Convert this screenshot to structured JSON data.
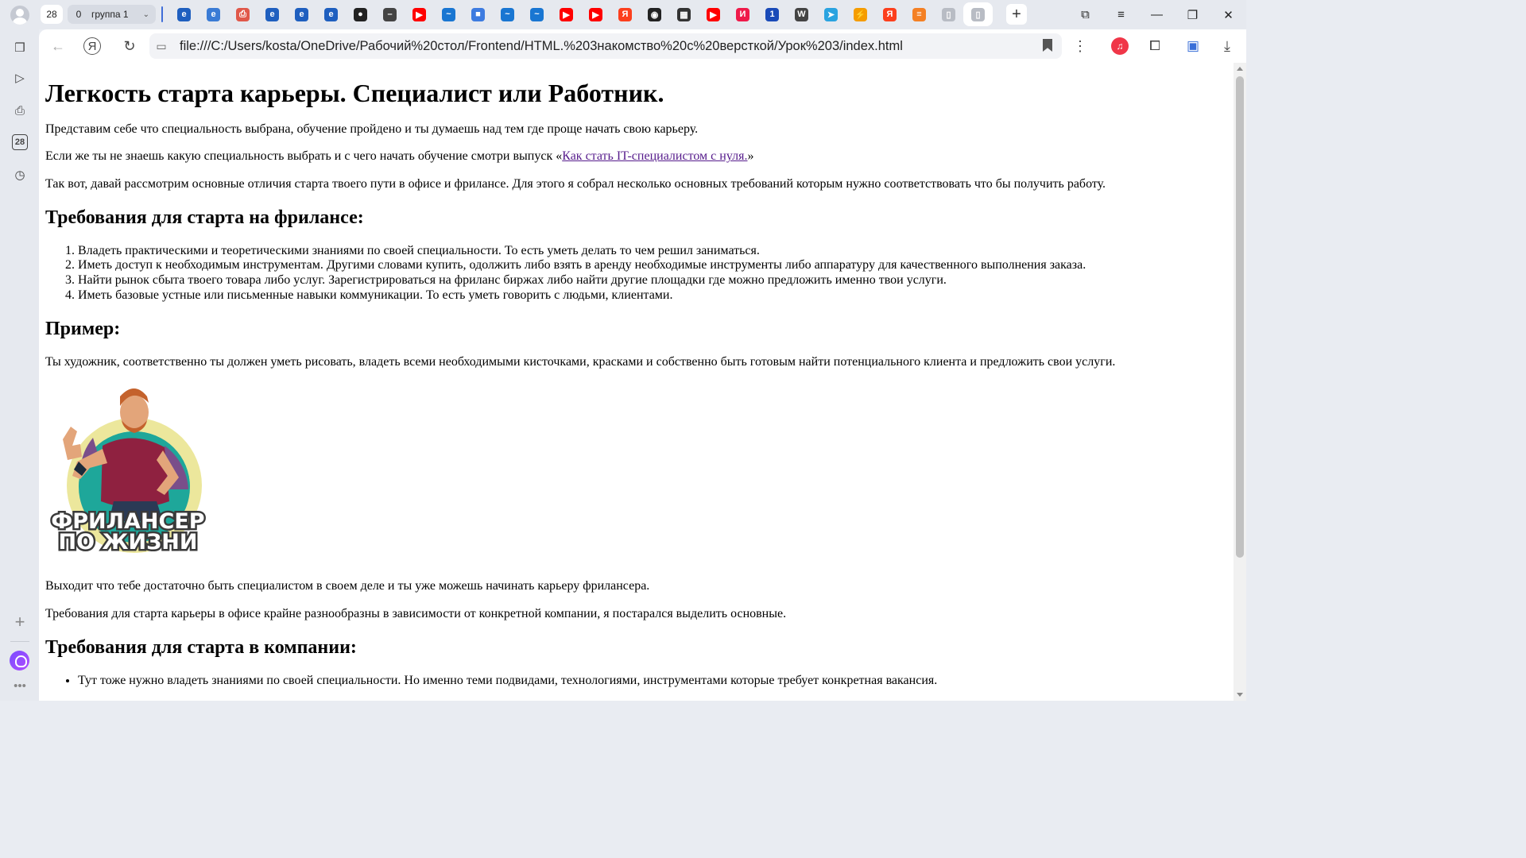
{
  "browser": {
    "tab_count": "28",
    "group": {
      "count": "0",
      "name": "группа 1"
    },
    "pinned_tabs": [
      {
        "name": "edge-icon",
        "color": "#1f5fbf",
        "glyph": "e"
      },
      {
        "name": "ie-icon",
        "color": "#3a7bd5",
        "glyph": "e"
      },
      {
        "name": "pdf-icon",
        "color": "#e0584a",
        "glyph": "⎙"
      },
      {
        "name": "edge-icon",
        "color": "#1f5fbf",
        "glyph": "e"
      },
      {
        "name": "edge-icon",
        "color": "#1f5fbf",
        "glyph": "e"
      },
      {
        "name": "edge-icon",
        "color": "#1f5fbf",
        "glyph": "e"
      },
      {
        "name": "github-icon",
        "color": "#222222",
        "glyph": "●"
      },
      {
        "name": "minus-icon",
        "color": "#444444",
        "glyph": "–"
      },
      {
        "name": "youtube-icon",
        "color": "#ff0000",
        "glyph": "▶"
      },
      {
        "name": "feather-icon",
        "color": "#1976d2",
        "glyph": "~"
      },
      {
        "name": "cube-icon",
        "color": "#3d7be0",
        "glyph": "■"
      },
      {
        "name": "feather-icon",
        "color": "#1976d2",
        "glyph": "~"
      },
      {
        "name": "feather-icon",
        "color": "#1976d2",
        "glyph": "~"
      },
      {
        "name": "youtube-icon",
        "color": "#ff0000",
        "glyph": "▶"
      },
      {
        "name": "youtube-icon",
        "color": "#ff0000",
        "glyph": "▶"
      },
      {
        "name": "yandex-icon",
        "color": "#fc3f1d",
        "glyph": "Я"
      },
      {
        "name": "power-icon",
        "color": "#222222",
        "glyph": "◉"
      },
      {
        "name": "book-icon",
        "color": "#333333",
        "glyph": "▦"
      },
      {
        "name": "youtube-icon",
        "color": "#ff0000",
        "glyph": "▶"
      },
      {
        "name": "yandex-music-icon",
        "color": "#ef1a4a",
        "glyph": "И"
      },
      {
        "name": "tv-icon",
        "color": "#1a4ab8",
        "glyph": "1"
      },
      {
        "name": "wikipedia-icon",
        "color": "#444444",
        "glyph": "W"
      },
      {
        "name": "telegram-icon",
        "color": "#2aa3e0",
        "glyph": "➤"
      },
      {
        "name": "lightning-icon",
        "color": "#f59c00",
        "glyph": "⚡"
      },
      {
        "name": "yandex-icon",
        "color": "#fc3f1d",
        "glyph": "Я"
      },
      {
        "name": "stack-icon",
        "color": "#f48024",
        "glyph": "≡"
      },
      {
        "name": "file-icon",
        "color": "#b8bcc4",
        "glyph": "▯"
      },
      {
        "name": "file-icon",
        "color": "#b8bcc4",
        "glyph": "▯"
      }
    ],
    "address_url": "file:///C:/Users/kosta/OneDrive/Рабочий%20стол/Frontend/HTML.%203накомство%20с%20версткой/Урок%203/index.html"
  },
  "sidebar": {
    "calendar_day": "28"
  },
  "page": {
    "title": "Легкость старта карьеры. Специалист или Работник.",
    "intro1": "Представим себе что специальность выбрана, обучение пройдено и ты думаешь над тем где проще начать свою карьеру.",
    "intro2_before": "Если же ты не знаешь какую специальность выбрать и с чего начать обучение смотри выпуск «",
    "intro2_link": "Как стать IT-специалистом с нуля.",
    "intro2_after": "»",
    "intro3": "Так вот, давай рассмотрим основные отличия старта твоего пути в офисе и фрилансе. Для этого я собрал несколько основных требований которым нужно соответствовать что бы получить работу.",
    "freelance_heading": "Требования для старта на фрилансе:",
    "freelance_items": [
      "Владеть практическими и теоретическими знаниями по своей специальности. То есть уметь делать то чем решил заниматься.",
      "Иметь доступ к необходимым инструментам. Другими словами купить, одолжить либо взять в аренду необходимые инструменты либо аппаратуру для качественного выполнения заказа.",
      "Найти рынок сбыта твоего товара либо услуг. Зарегистрироваться на фриланс биржах либо найти другие площадки где можно предложить именно твои услуги.",
      "Иметь базовые устные или письменные навыки коммуникации. То есть уметь говорить с людьми, клиентами."
    ],
    "example_heading": "Пример:",
    "example_text": "Ты художник, соответственно ты должен уметь рисовать, владеть всеми необходимыми кисточками, красками и собственно быть готовым найти потенциального клиента и предложить свои услуги.",
    "logo_line1": "ФРИЛАНСЕР",
    "logo_line2": "ПО ЖИЗНИ",
    "after1": "Выходит что тебе достаточно быть специалистом в своем деле и ты уже можешь начинать карьеру фрилансера.",
    "after2": "Требования для старта карьеры в офисе крайне разнообразны в зависимости от конкретной компании, я постарался выделить основные.",
    "company_heading": "Требования для старта в компании:",
    "company_items": [
      "Тут тоже нужно владеть знаниями по своей специальности. Но именно теми подвидами, технологиями, инструментами которые требует конкретная вакансия."
    ]
  }
}
